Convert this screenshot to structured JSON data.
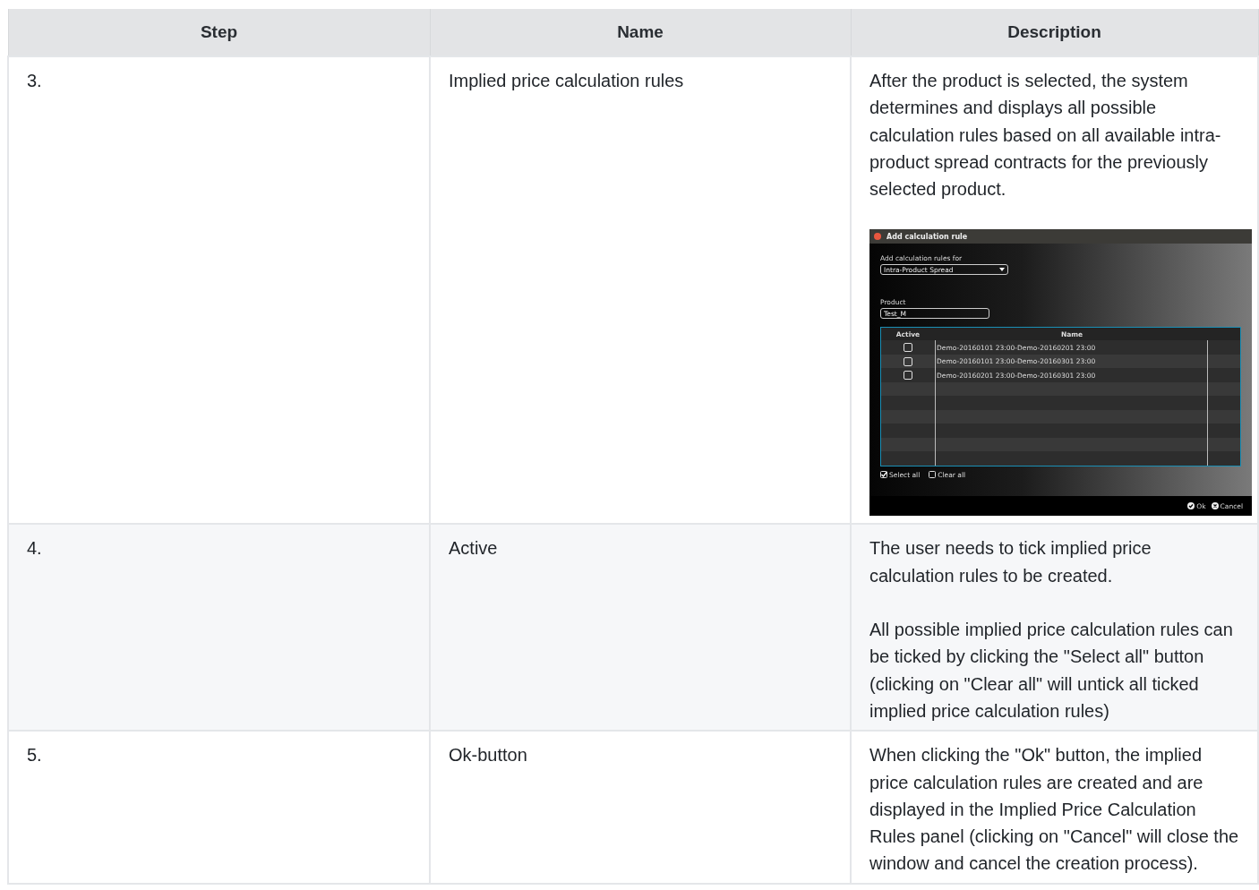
{
  "table": {
    "columns": [
      "Step",
      "Name",
      "Description"
    ],
    "rows": [
      {
        "step": "3.",
        "name": "Implied price calculation rules",
        "description": [
          "After the product is selected, the system determines and displays all possible calculation rules based on all available intra-product spread contracts for the previously selected product."
        ],
        "screenshot": {
          "title": "Add calculation rule",
          "rules_for_label": "Add calculation rules for",
          "rules_for_value": "Intra-Product Spread",
          "product_label": "Product",
          "product_value": "Test_M",
          "grid_columns": [
            "Active",
            "Name"
          ],
          "grid_rows": [
            {
              "checked": false,
              "name": "Demo-20160101 23:00-Demo-20160201 23:00"
            },
            {
              "checked": false,
              "name": "Demo-20160101 23:00-Demo-20160301 23:00"
            },
            {
              "checked": false,
              "name": "Demo-20160201 23:00-Demo-20160301 23:00"
            }
          ],
          "select_all": {
            "label": "Select all",
            "checked": true
          },
          "clear_all": {
            "label": "Clear all",
            "checked": false
          },
          "buttons": [
            {
              "kind": "ok",
              "label": "Ok"
            },
            {
              "kind": "cancel",
              "label": "Cancel"
            }
          ]
        }
      },
      {
        "step": "4.",
        "name": "Active",
        "description": [
          "The user needs to tick implied price calculation rules to be created.",
          "All possible implied price calculation rules can be ticked by clicking the \"Select all\" button (clicking on \"Clear all\" will untick all ticked implied price calculation rules)"
        ]
      },
      {
        "step": "5.",
        "name": "Ok-button",
        "description": [
          "When clicking the \"Ok\" button, the implied price calculation rules are created and are displayed in the Implied Price Calculation Rules panel (clicking on \"Cancel\" will close the window and cancel the creation process)."
        ]
      }
    ]
  }
}
